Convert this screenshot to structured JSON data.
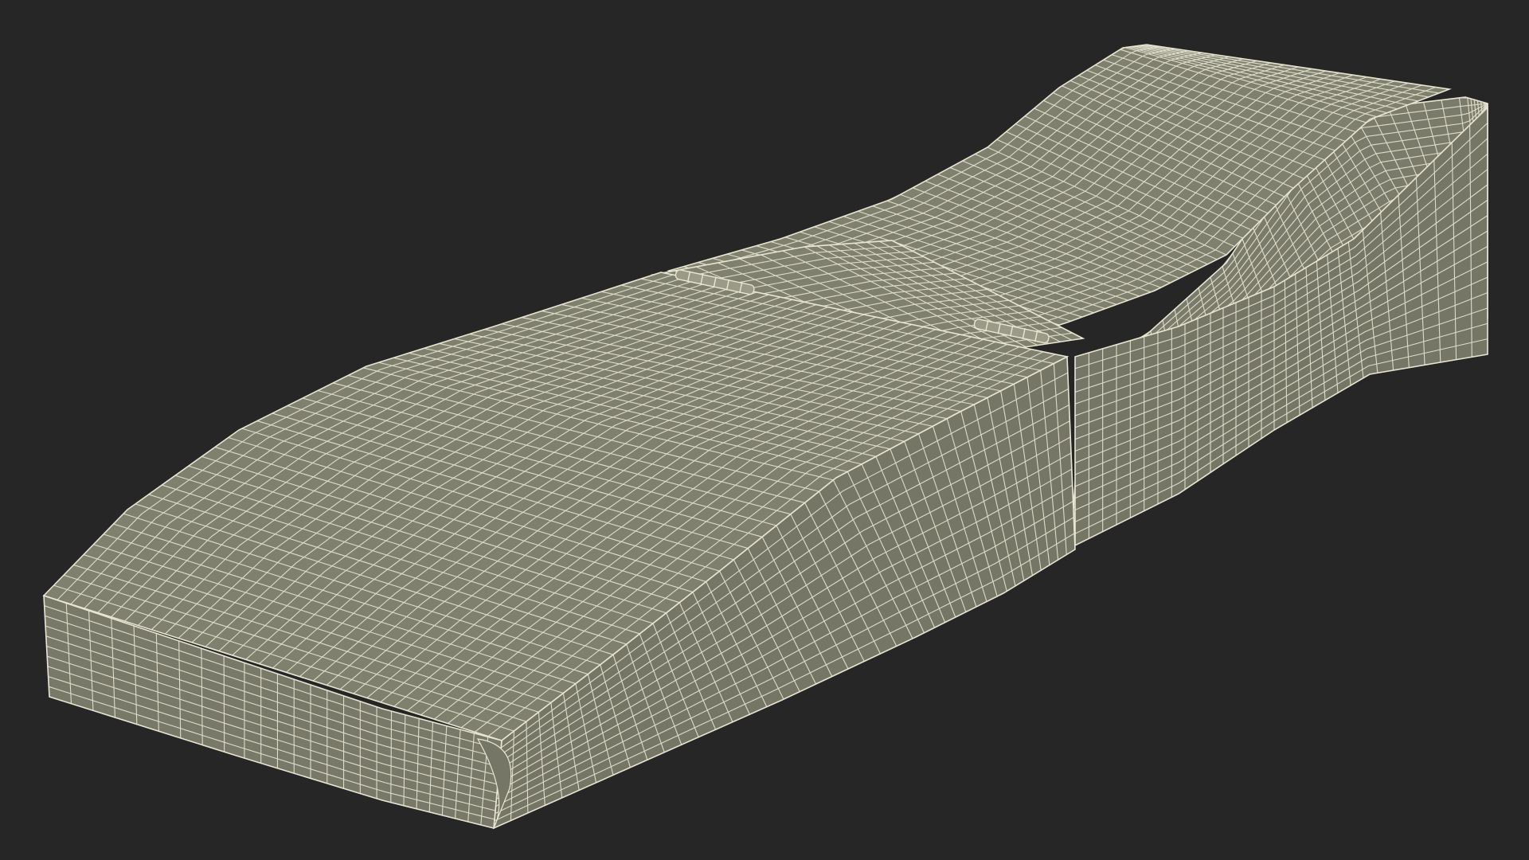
{
  "scene": {
    "subject": "wireframe-lounger-cushion",
    "colors": {
      "background": "#262626",
      "surface_top": "#80806f",
      "surface_front": "#797969",
      "surface_side": "#767666",
      "surface_back": "#7b7b6b",
      "wire": "#e9e7d4"
    },
    "icons": {
      "hinge_left": "hinge-icon",
      "hinge_right": "hinge-icon"
    }
  }
}
